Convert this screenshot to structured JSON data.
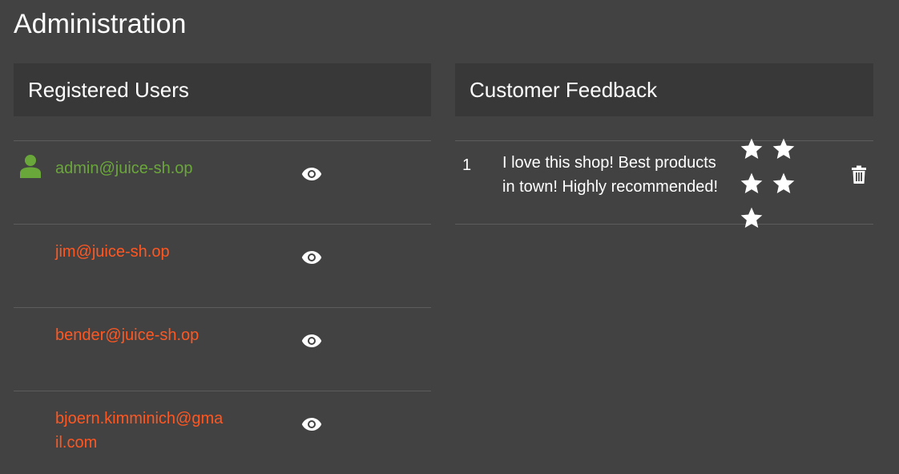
{
  "page": {
    "title": "Administration"
  },
  "users_panel": {
    "title": "Registered Users",
    "users": [
      {
        "email": "admin@juice-sh.op",
        "role": "admin",
        "view_icon": "eye-icon"
      },
      {
        "email": "jim@juice-sh.op",
        "role": "customer",
        "view_icon": "eye-icon"
      },
      {
        "email": "bender@juice-sh.op",
        "role": "customer",
        "view_icon": "eye-icon"
      },
      {
        "email": "bjoern.kimminich@gmail.com",
        "role": "customer",
        "view_icon": "eye-icon"
      }
    ]
  },
  "feedback_panel": {
    "title": "Customer Feedback",
    "items": [
      {
        "id": "1",
        "comment_line1": "I love this shop! Best products",
        "comment_line2": "in town! Highly recommended!",
        "rating": 5,
        "delete_icon": "trash-icon"
      }
    ]
  },
  "colors": {
    "background": "#424242",
    "header_background": "#383838",
    "admin_user": "#6aa73a",
    "customer_user": "#ff5722",
    "divider": "#5c5c5c",
    "text": "#ffffff"
  },
  "icons": {
    "admin_avatar": "person-icon",
    "view": "eye-icon",
    "star": "star-icon",
    "delete": "trash-icon"
  }
}
